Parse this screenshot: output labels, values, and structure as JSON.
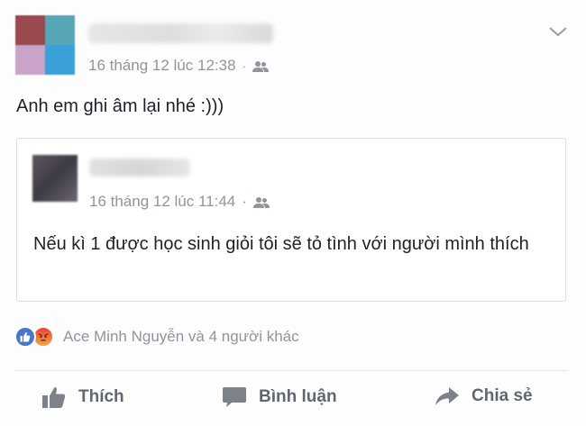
{
  "post": {
    "timestamp": "16 tháng 12 lúc 12:38",
    "separator": "·",
    "audience_icon": "friends-icon",
    "menu_icon": "chevron-down-icon",
    "text": "Anh em ghi âm lại nhé :)))"
  },
  "shared_post": {
    "timestamp": "16 tháng 12 lúc 11:44",
    "separator": "·",
    "audience_icon": "friends-icon",
    "text": "Nếu kì 1 được học sinh giỏi tôi sẽ tỏ tình với người mình thích"
  },
  "reactions": {
    "icons": [
      "like-icon",
      "angry-icon"
    ],
    "summary": "Ace Minh Nguyễn và 4 người khác"
  },
  "actions": {
    "like_label": "Thích",
    "comment_label": "Bình luận",
    "share_label": "Chia sẻ"
  },
  "colors": {
    "like_blue": "#4a76c9",
    "meta_gray": "#90949c",
    "action_gray": "#606770",
    "text": "#1d2129"
  }
}
